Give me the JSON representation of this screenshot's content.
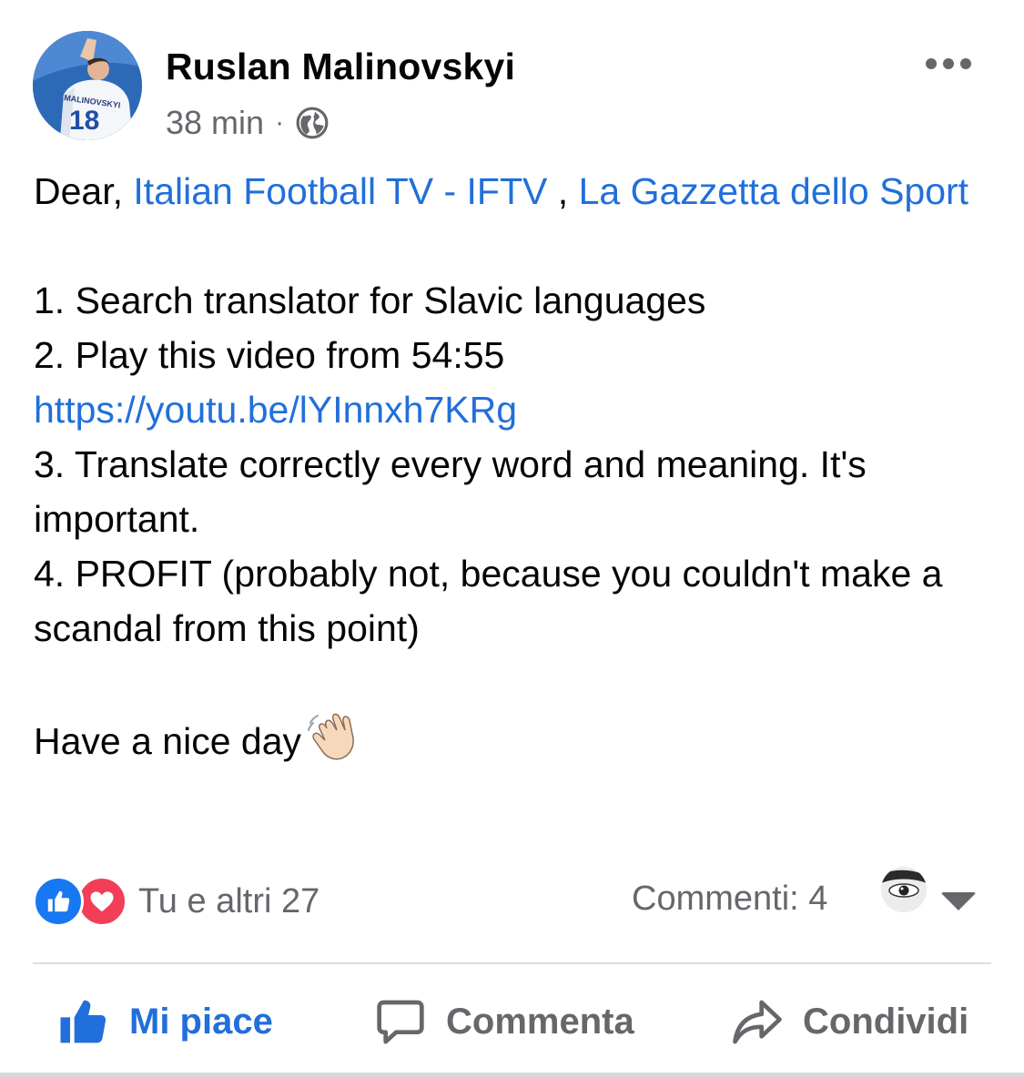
{
  "post": {
    "author": "Ruslan Malinovskyi",
    "time": "38 min",
    "separator": "·",
    "privacy_icon": "globe-icon",
    "avatar_text": "MALINOVSKYI",
    "avatar_number": "18",
    "greeting": "Dear,",
    "tag_1": "Italian Football TV - IFTV",
    "tag_sep": ",",
    "tag_2": "La Gazzetta dello Sport",
    "line_1": "1. Search translator for Slavic languages",
    "line_2_text": "2. Play this video from 54:55",
    "line_2_link": "https://youtu.be/lYInnxh7KRg",
    "line_3": "3. Translate correctly every word and meaning. It's important.",
    "line_4": "4. PROFIT (probably not, because you couldn't make a scandal from this point)",
    "closing": "Have a nice day",
    "closing_emoji": "waving-hand-emoji"
  },
  "reactions": {
    "icons": [
      "like-reaction-icon",
      "love-reaction-icon"
    ],
    "summary": "Tu e altri 27"
  },
  "comments": {
    "label": "Commenti: 4"
  },
  "actions": {
    "like": "Mi piace",
    "comment": "Commenta",
    "share": "Condividi"
  },
  "colors": {
    "link": "#216fdb",
    "like_active": "#216fdb",
    "secondary_text": "#65676b",
    "like_reaction": "#1877f2",
    "love_reaction": "#f33e58"
  }
}
